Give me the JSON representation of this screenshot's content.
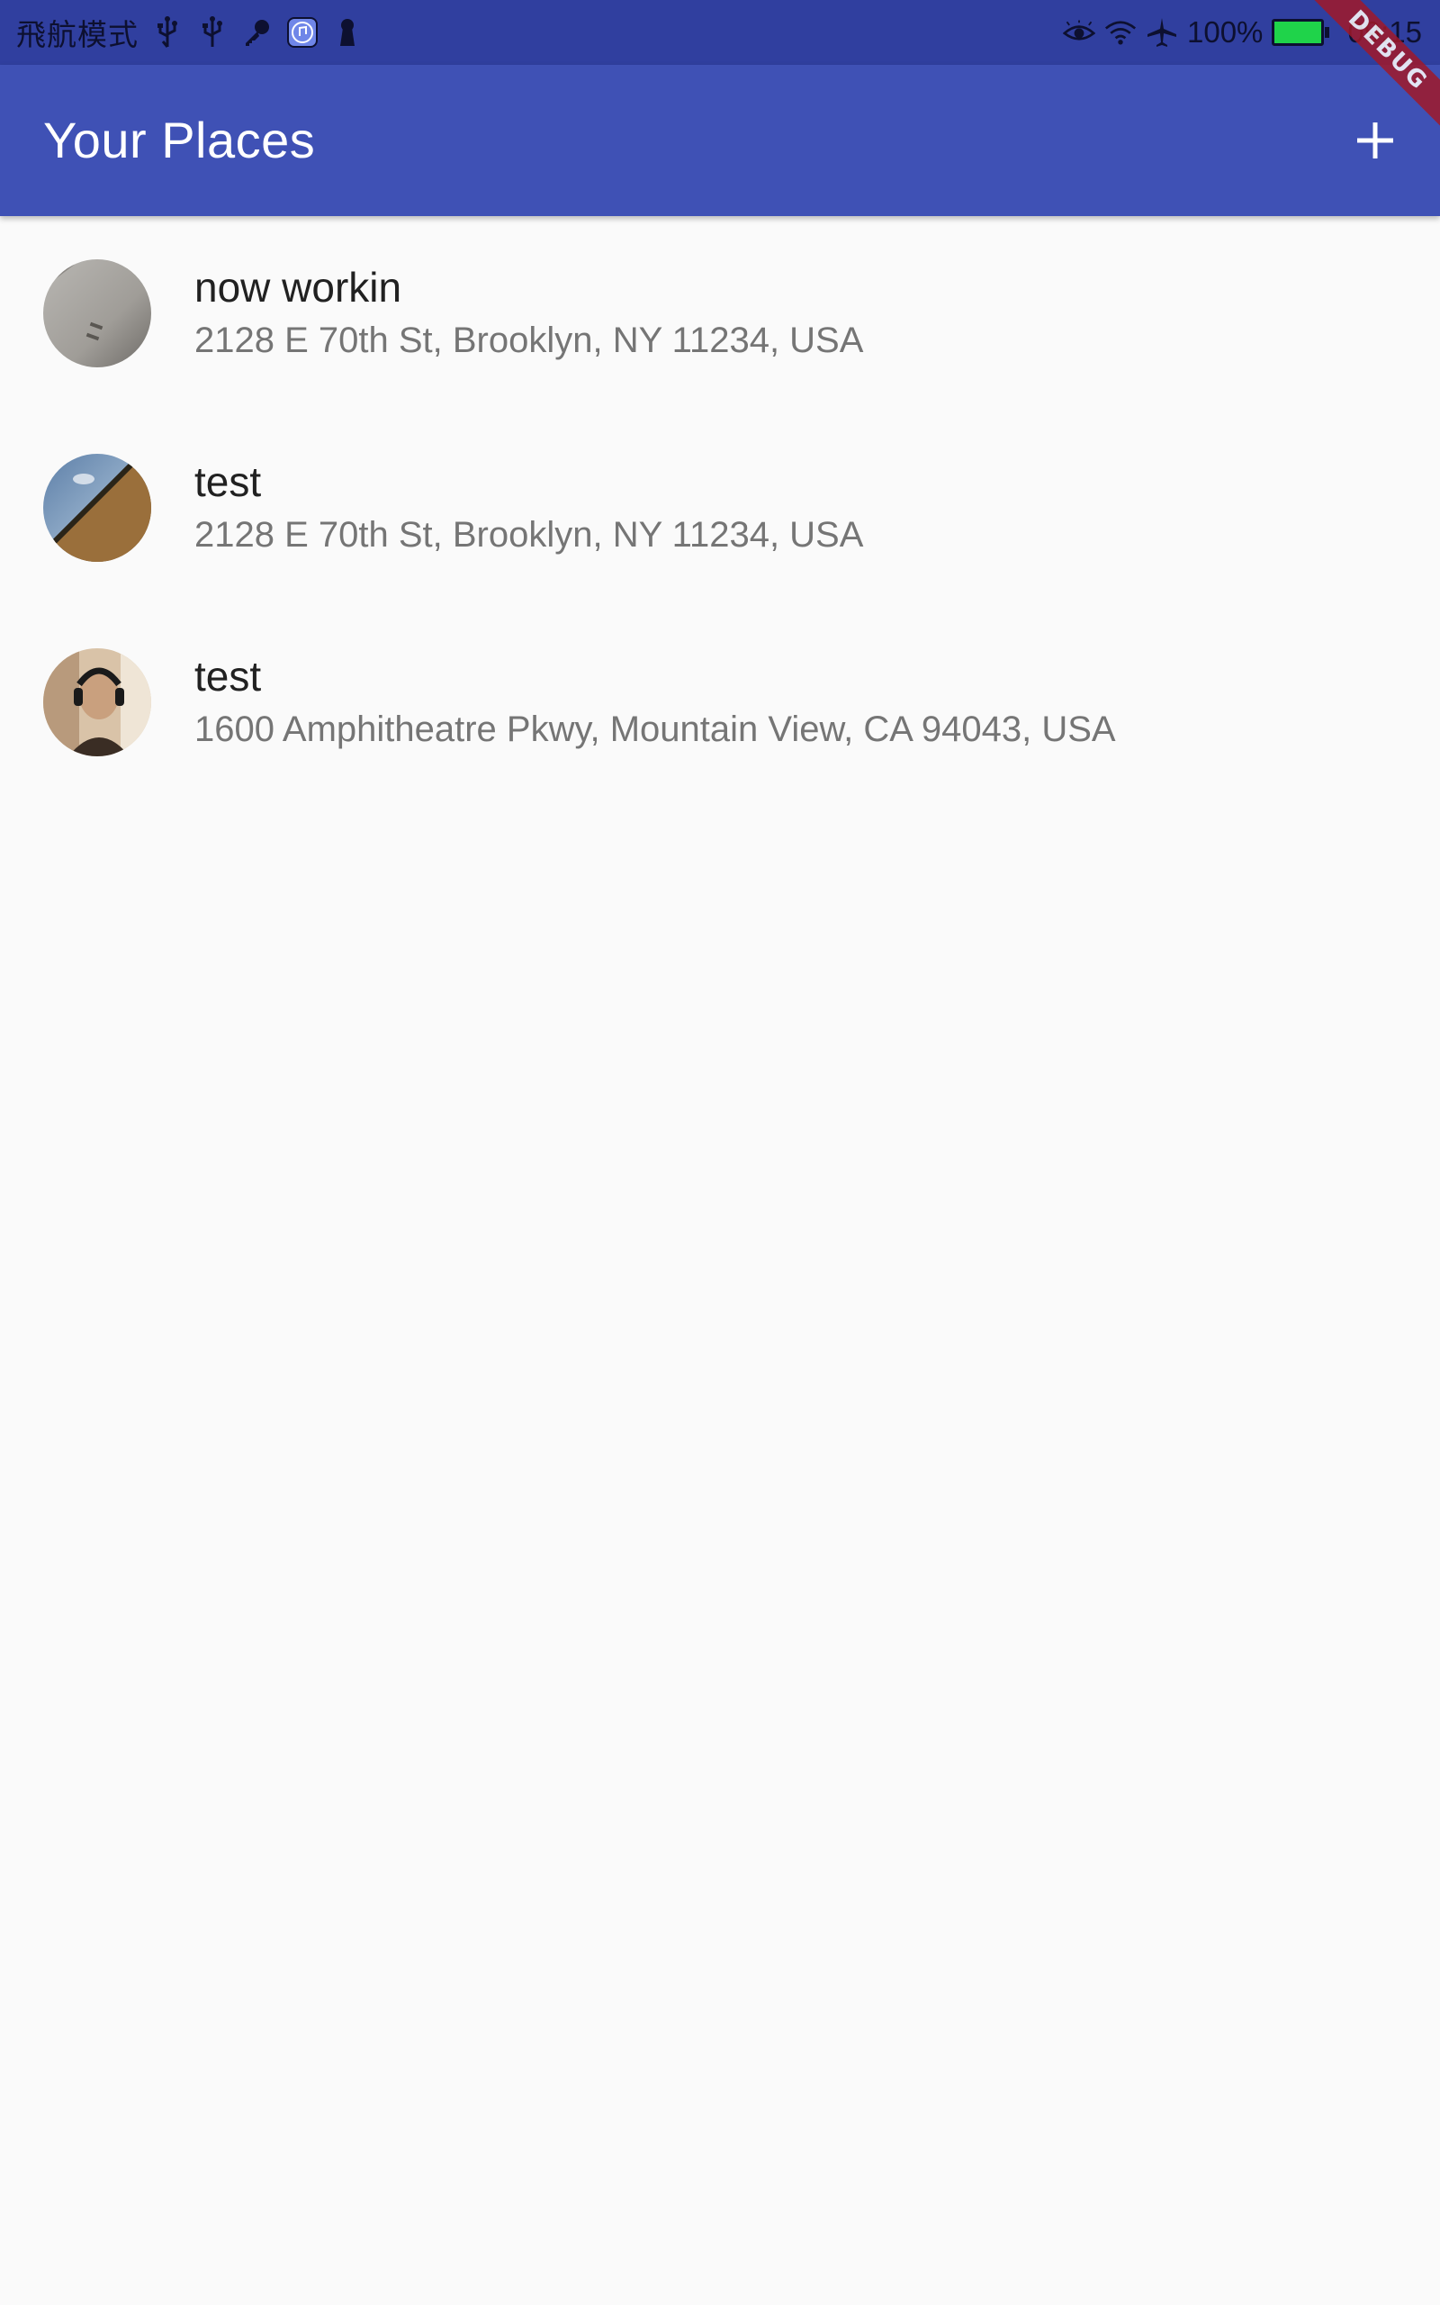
{
  "status_bar": {
    "carrier_text": "飛航模式",
    "battery_percent": "100%",
    "time": "09:15",
    "left_icons": [
      "usb-icon",
      "usb-icon",
      "key-icon",
      "music-app-icon",
      "keyhole-icon"
    ],
    "right_icons": [
      "eye-icon",
      "wifi-icon",
      "airplane-icon",
      "battery-charging-icon"
    ]
  },
  "app_bar": {
    "title": "Your Places",
    "action_icon": "add-icon"
  },
  "debug_banner": "DEBUG",
  "places": [
    {
      "title": "now workin",
      "address": "2128 E 70th St, Brooklyn, NY 11234, USA",
      "thumbnail": "photo-gray-wall"
    },
    {
      "title": "test",
      "address": "2128 E 70th St, Brooklyn, NY 11234, USA",
      "thumbnail": "photo-ceiling"
    },
    {
      "title": "test",
      "address": "1600 Amphitheatre Pkwy, Mountain View, CA 94043, USA",
      "thumbnail": "photo-person-headphones"
    }
  ],
  "colors": {
    "status_bar": "#303f9f",
    "app_bar": "#3f51b5",
    "background": "#fafafa",
    "title_text": "#212121",
    "subtitle_text": "#757575",
    "debug_banner": "#a0192a"
  }
}
